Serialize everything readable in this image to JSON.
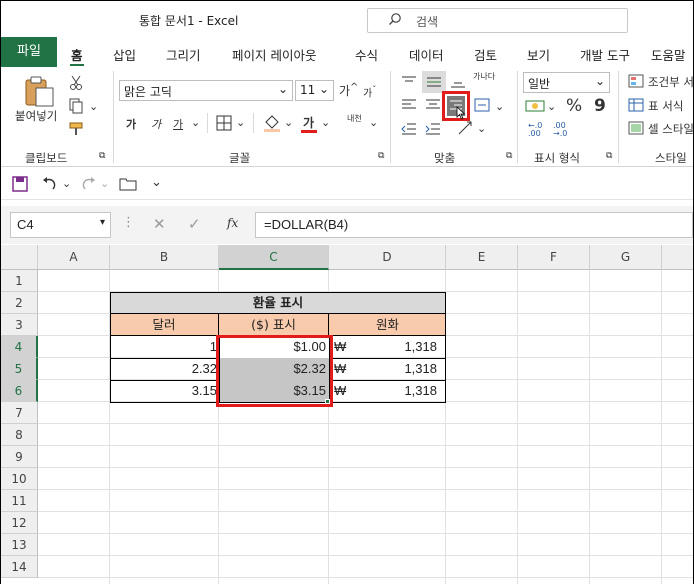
{
  "window": {
    "title": "통합 문서1  -  Excel",
    "search_placeholder": "검색"
  },
  "tabs": [
    {
      "id": "file",
      "label": "파일"
    },
    {
      "id": "home",
      "label": "홈"
    },
    {
      "id": "insert",
      "label": "삽입"
    },
    {
      "id": "draw",
      "label": "그리기"
    },
    {
      "id": "layout",
      "label": "페이지 레이아웃"
    },
    {
      "id": "formulas",
      "label": "수식"
    },
    {
      "id": "data",
      "label": "데이터"
    },
    {
      "id": "review",
      "label": "검토"
    },
    {
      "id": "view",
      "label": "보기"
    },
    {
      "id": "developer",
      "label": "개발 도구"
    },
    {
      "id": "help",
      "label": "도움말"
    }
  ],
  "ribbon": {
    "clipboard": {
      "paste_label": "붙여넣기",
      "group_label": "클립보드"
    },
    "font": {
      "family": "맑은 고딕",
      "size": "11",
      "bold": "가",
      "italic": "가",
      "underline": "가",
      "font_color_glyph": "가",
      "phonetic": "내천",
      "increase": "가",
      "decrease": "가",
      "group_label": "글꼴"
    },
    "alignment": {
      "wrap_label": "가나다",
      "group_label": "맞춤"
    },
    "number": {
      "format": "일반",
      "percent": "%",
      "comma": "9",
      "inc_dec1": "←.0",
      "inc_dec2": ".00",
      "inc_dec3": ".00",
      "inc_dec4": "→.0",
      "group_label": "표시 형식"
    },
    "styles": {
      "conditional": "조건부 서",
      "table_format": "표 서식",
      "cell_style": "셀 스타일",
      "group_label": "스타일"
    }
  },
  "formula_bar": {
    "name_box": "C4",
    "formula": "=DOLLAR(B4)",
    "fx": "fx"
  },
  "columns": [
    "A",
    "B",
    "C",
    "D",
    "E",
    "F",
    "G"
  ],
  "rows": [
    "1",
    "2",
    "3",
    "4",
    "5",
    "6",
    "7",
    "8",
    "9",
    "10",
    "11",
    "12",
    "13",
    "14"
  ],
  "sheet": {
    "title": "환율 표시",
    "headers": [
      "달러",
      "($) 표시",
      "원화"
    ],
    "data": [
      {
        "dollar": "1",
        "display": "$1.00",
        "won_symbol": "₩",
        "won": "1,318"
      },
      {
        "dollar": "2.32",
        "display": "$2.32",
        "won_symbol": "₩",
        "won": "1,318"
      },
      {
        "dollar": "3.15",
        "display": "$3.15",
        "won_symbol": "₩",
        "won": "1,318"
      }
    ]
  },
  "colors": {
    "accent": "#217346",
    "header_peach": "#f8cbad",
    "title_gray": "#d9d9d9",
    "selection": "#c6c6c6",
    "highlight_red": "#e21b1b"
  }
}
